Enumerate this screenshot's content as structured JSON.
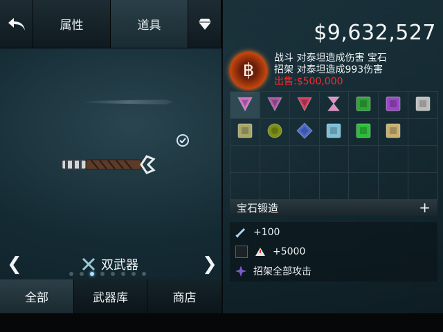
{
  "tabs": {
    "attr_label": "属性",
    "items_label": "道具"
  },
  "category": {
    "label": "双武器",
    "dots_count": 8,
    "active_dot": 2
  },
  "bottom_tabs": [
    {
      "label": "全部"
    },
    {
      "label": "武器库"
    },
    {
      "label": "商店"
    }
  ],
  "money": "$9,632,527",
  "gem_detail": {
    "line1": "战斗  对泰坦造成伤害 宝石",
    "line2": "招架  对泰坦造成993伤害",
    "sell": "出售:$500,000"
  },
  "gems": [
    {
      "shape": "tri",
      "color": "#d070c8",
      "selected": true
    },
    {
      "shape": "tri",
      "color": "#b05aa8"
    },
    {
      "shape": "tri",
      "color": "#d0405e"
    },
    {
      "shape": "hourglass",
      "color": "#e58ac2"
    },
    {
      "shape": "square",
      "color": "#2ea536"
    },
    {
      "shape": "square",
      "color": "#9a48c8"
    },
    {
      "shape": "square",
      "color": "#bdbdbd"
    },
    {
      "shape": "square",
      "color": "#a8a768"
    },
    {
      "shape": "circle",
      "color": "#7d8f15"
    },
    {
      "shape": "diamond",
      "color": "#4e6ad0"
    },
    {
      "shape": "square",
      "color": "#7cc0d8"
    },
    {
      "shape": "square",
      "color": "#2ebd3a"
    },
    {
      "shape": "square",
      "color": "#c8b070"
    }
  ],
  "forge": {
    "label": "宝石锻造",
    "plus": "+"
  },
  "stats": {
    "attack": "+100",
    "parry_bonus": "+5000",
    "parry_all": "招架全部攻击"
  }
}
